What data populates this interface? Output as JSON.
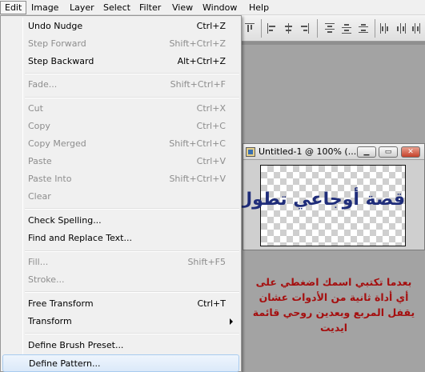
{
  "menubar": {
    "items": [
      "Edit",
      "Image",
      "Layer",
      "Select",
      "Filter",
      "View",
      "Window",
      "Help"
    ],
    "active": "Edit"
  },
  "edit_menu": {
    "items": [
      {
        "label": "Undo Nudge",
        "shortcut": "Ctrl+Z",
        "enabled": true
      },
      {
        "label": "Step Forward",
        "shortcut": "Shift+Ctrl+Z",
        "enabled": false
      },
      {
        "label": "Step Backward",
        "shortcut": "Alt+Ctrl+Z",
        "enabled": true
      },
      {
        "label": "Fade...",
        "shortcut": "Shift+Ctrl+F",
        "enabled": false
      },
      {
        "label": "Cut",
        "shortcut": "Ctrl+X",
        "enabled": false
      },
      {
        "label": "Copy",
        "shortcut": "Ctrl+C",
        "enabled": false
      },
      {
        "label": "Copy Merged",
        "shortcut": "Shift+Ctrl+C",
        "enabled": false
      },
      {
        "label": "Paste",
        "shortcut": "Ctrl+V",
        "enabled": false
      },
      {
        "label": "Paste Into",
        "shortcut": "Shift+Ctrl+V",
        "enabled": false
      },
      {
        "label": "Clear",
        "shortcut": "",
        "enabled": false
      },
      {
        "label": "Check Spelling...",
        "shortcut": "",
        "enabled": true
      },
      {
        "label": "Find and Replace Text...",
        "shortcut": "",
        "enabled": true
      },
      {
        "label": "Fill...",
        "shortcut": "Shift+F5",
        "enabled": false
      },
      {
        "label": "Stroke...",
        "shortcut": "",
        "enabled": false
      },
      {
        "label": "Free Transform",
        "shortcut": "Ctrl+T",
        "enabled": true
      },
      {
        "label": "Transform",
        "shortcut": "",
        "enabled": true,
        "submenu": true
      },
      {
        "label": "Define Brush Preset...",
        "shortcut": "",
        "enabled": true
      },
      {
        "label": "Define Pattern...",
        "shortcut": "",
        "enabled": true,
        "highlighted": true
      }
    ]
  },
  "document": {
    "title": "Untitled-1 @ 100% (...",
    "minimize": "▁",
    "restore": "▭",
    "close": "✕",
    "canvas_text": "قصة أوجاعي تطول"
  },
  "note": {
    "lines": [
      "بعدما تكتبي اسمك اضغطي على",
      "أي أداة ثانية من الأدوات عشان",
      "يقفل المربع وبعدين روحي قائمة",
      "ايديت"
    ]
  },
  "colors": {
    "note_text": "#a50f0f",
    "canvas_text": "#1f2d7a",
    "menu_highlight": "#dbe9f9"
  }
}
